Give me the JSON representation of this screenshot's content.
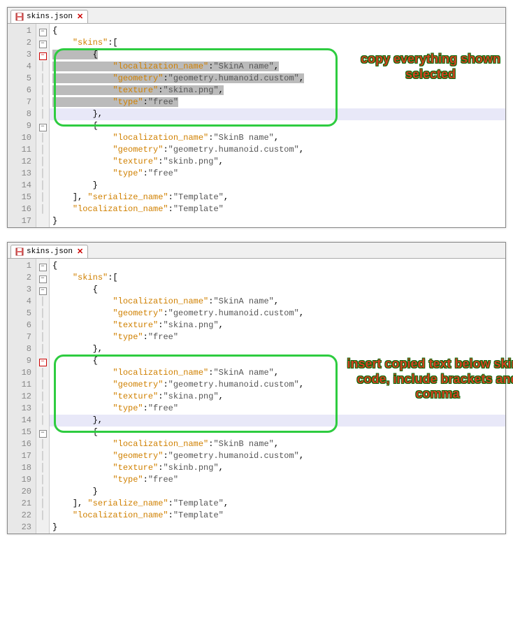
{
  "tab": {
    "filename": "skins.json"
  },
  "annotations": {
    "top": "copy everything\nshown selected",
    "bottom": "insert copied text\nbelow skinA code,\ninclude brackets and\ncomma"
  },
  "top_editor": {
    "lines": [
      {
        "n": 1,
        "fold": "minus",
        "indent": 0,
        "tokens": [
          {
            "t": "p",
            "v": "{"
          }
        ]
      },
      {
        "n": 2,
        "fold": "minus",
        "indent": 1,
        "tokens": [
          {
            "t": "k",
            "v": "\"skins\""
          },
          {
            "t": "p",
            "v": ":["
          }
        ]
      },
      {
        "n": 3,
        "fold": "minus-red",
        "indent": 2,
        "selected": true,
        "tokens": [
          {
            "t": "p",
            "v": "{"
          }
        ]
      },
      {
        "n": 4,
        "fold": "line",
        "indent": 3,
        "selected": true,
        "tokens": [
          {
            "t": "k",
            "v": "\"localization_name\""
          },
          {
            "t": "p",
            "v": ":"
          },
          {
            "t": "s",
            "v": "\"SkinA name\""
          },
          {
            "t": "p",
            "v": ","
          }
        ]
      },
      {
        "n": 5,
        "fold": "line",
        "indent": 3,
        "selected": true,
        "tokens": [
          {
            "t": "k",
            "v": "\"geometry\""
          },
          {
            "t": "p",
            "v": ":"
          },
          {
            "t": "s",
            "v": "\"geometry.humanoid.custom\""
          },
          {
            "t": "p",
            "v": ","
          }
        ]
      },
      {
        "n": 6,
        "fold": "line",
        "indent": 3,
        "selected": true,
        "tokens": [
          {
            "t": "k",
            "v": "\"texture\""
          },
          {
            "t": "p",
            "v": ":"
          },
          {
            "t": "s",
            "v": "\"skina.png\""
          },
          {
            "t": "p",
            "v": ","
          }
        ]
      },
      {
        "n": 7,
        "fold": "line",
        "indent": 3,
        "selected": true,
        "tokens": [
          {
            "t": "k",
            "v": "\"type\""
          },
          {
            "t": "p",
            "v": ":"
          },
          {
            "t": "s",
            "v": "\"free\""
          }
        ]
      },
      {
        "n": 8,
        "fold": "line",
        "indent": 2,
        "cursor": true,
        "tokens": [
          {
            "t": "p",
            "v": "},"
          }
        ]
      },
      {
        "n": 9,
        "fold": "minus",
        "indent": 2,
        "tokens": [
          {
            "t": "p",
            "v": "{"
          }
        ]
      },
      {
        "n": 10,
        "fold": "line",
        "indent": 3,
        "tokens": [
          {
            "t": "k",
            "v": "\"localization_name\""
          },
          {
            "t": "p",
            "v": ":"
          },
          {
            "t": "s",
            "v": "\"SkinB name\""
          },
          {
            "t": "p",
            "v": ","
          }
        ]
      },
      {
        "n": 11,
        "fold": "line",
        "indent": 3,
        "tokens": [
          {
            "t": "k",
            "v": "\"geometry\""
          },
          {
            "t": "p",
            "v": ":"
          },
          {
            "t": "s",
            "v": "\"geometry.humanoid.custom\""
          },
          {
            "t": "p",
            "v": ","
          }
        ]
      },
      {
        "n": 12,
        "fold": "line",
        "indent": 3,
        "tokens": [
          {
            "t": "k",
            "v": "\"texture\""
          },
          {
            "t": "p",
            "v": ":"
          },
          {
            "t": "s",
            "v": "\"skinb.png\""
          },
          {
            "t": "p",
            "v": ","
          }
        ]
      },
      {
        "n": 13,
        "fold": "line",
        "indent": 3,
        "tokens": [
          {
            "t": "k",
            "v": "\"type\""
          },
          {
            "t": "p",
            "v": ":"
          },
          {
            "t": "s",
            "v": "\"free\""
          }
        ]
      },
      {
        "n": 14,
        "fold": "line",
        "indent": 2,
        "tokens": [
          {
            "t": "p",
            "v": "}"
          }
        ]
      },
      {
        "n": 15,
        "fold": "line",
        "indent": 1,
        "tokens": [
          {
            "t": "p",
            "v": "], "
          },
          {
            "t": "k",
            "v": "\"serialize_name\""
          },
          {
            "t": "p",
            "v": ":"
          },
          {
            "t": "s",
            "v": "\"Template\""
          },
          {
            "t": "p",
            "v": ","
          }
        ]
      },
      {
        "n": 16,
        "fold": "line",
        "indent": 1,
        "tokens": [
          {
            "t": "k",
            "v": "\"localization_name\""
          },
          {
            "t": "p",
            "v": ":"
          },
          {
            "t": "s",
            "v": "\"Template\""
          }
        ]
      },
      {
        "n": 17,
        "fold": "",
        "indent": 0,
        "tokens": [
          {
            "t": "p",
            "v": "}"
          }
        ]
      }
    ]
  },
  "bottom_editor": {
    "lines": [
      {
        "n": 1,
        "fold": "minus",
        "indent": 0,
        "tokens": [
          {
            "t": "p",
            "v": "{"
          }
        ]
      },
      {
        "n": 2,
        "fold": "minus",
        "indent": 1,
        "tokens": [
          {
            "t": "k",
            "v": "\"skins\""
          },
          {
            "t": "p",
            "v": ":["
          }
        ]
      },
      {
        "n": 3,
        "fold": "minus",
        "indent": 2,
        "tokens": [
          {
            "t": "p",
            "v": "{"
          }
        ]
      },
      {
        "n": 4,
        "fold": "line",
        "indent": 3,
        "tokens": [
          {
            "t": "k",
            "v": "\"localization_name\""
          },
          {
            "t": "p",
            "v": ":"
          },
          {
            "t": "s",
            "v": "\"SkinA name\""
          },
          {
            "t": "p",
            "v": ","
          }
        ]
      },
      {
        "n": 5,
        "fold": "line",
        "indent": 3,
        "tokens": [
          {
            "t": "k",
            "v": "\"geometry\""
          },
          {
            "t": "p",
            "v": ":"
          },
          {
            "t": "s",
            "v": "\"geometry.humanoid.custom\""
          },
          {
            "t": "p",
            "v": ","
          }
        ]
      },
      {
        "n": 6,
        "fold": "line",
        "indent": 3,
        "tokens": [
          {
            "t": "k",
            "v": "\"texture\""
          },
          {
            "t": "p",
            "v": ":"
          },
          {
            "t": "s",
            "v": "\"skina.png\""
          },
          {
            "t": "p",
            "v": ","
          }
        ]
      },
      {
        "n": 7,
        "fold": "line",
        "indent": 3,
        "tokens": [
          {
            "t": "k",
            "v": "\"type\""
          },
          {
            "t": "p",
            "v": ":"
          },
          {
            "t": "s",
            "v": "\"free\""
          }
        ]
      },
      {
        "n": 8,
        "fold": "line",
        "indent": 2,
        "tokens": [
          {
            "t": "p",
            "v": "},"
          }
        ]
      },
      {
        "n": 9,
        "fold": "minus-red",
        "indent": 2,
        "tokens": [
          {
            "t": "p",
            "v": "{"
          }
        ]
      },
      {
        "n": 10,
        "fold": "line",
        "indent": 3,
        "tokens": [
          {
            "t": "k",
            "v": "\"localization_name\""
          },
          {
            "t": "p",
            "v": ":"
          },
          {
            "t": "s",
            "v": "\"SkinA name\""
          },
          {
            "t": "p",
            "v": ","
          }
        ]
      },
      {
        "n": 11,
        "fold": "line",
        "indent": 3,
        "tokens": [
          {
            "t": "k",
            "v": "\"geometry\""
          },
          {
            "t": "p",
            "v": ":"
          },
          {
            "t": "s",
            "v": "\"geometry.humanoid.custom\""
          },
          {
            "t": "p",
            "v": ","
          }
        ]
      },
      {
        "n": 12,
        "fold": "line",
        "indent": 3,
        "tokens": [
          {
            "t": "k",
            "v": "\"texture\""
          },
          {
            "t": "p",
            "v": ":"
          },
          {
            "t": "s",
            "v": "\"skina.png\""
          },
          {
            "t": "p",
            "v": ","
          }
        ]
      },
      {
        "n": 13,
        "fold": "line",
        "indent": 3,
        "tokens": [
          {
            "t": "k",
            "v": "\"type\""
          },
          {
            "t": "p",
            "v": ":"
          },
          {
            "t": "s",
            "v": "\"free\""
          }
        ]
      },
      {
        "n": 14,
        "fold": "line",
        "indent": 2,
        "cursor": true,
        "tokens": [
          {
            "t": "p",
            "v": "},"
          }
        ]
      },
      {
        "n": 15,
        "fold": "minus",
        "indent": 2,
        "tokens": [
          {
            "t": "p",
            "v": "{"
          }
        ]
      },
      {
        "n": 16,
        "fold": "line",
        "indent": 3,
        "tokens": [
          {
            "t": "k",
            "v": "\"localization_name\""
          },
          {
            "t": "p",
            "v": ":"
          },
          {
            "t": "s",
            "v": "\"SkinB name\""
          },
          {
            "t": "p",
            "v": ","
          }
        ]
      },
      {
        "n": 17,
        "fold": "line",
        "indent": 3,
        "tokens": [
          {
            "t": "k",
            "v": "\"geometry\""
          },
          {
            "t": "p",
            "v": ":"
          },
          {
            "t": "s",
            "v": "\"geometry.humanoid.custom\""
          },
          {
            "t": "p",
            "v": ","
          }
        ]
      },
      {
        "n": 18,
        "fold": "line",
        "indent": 3,
        "tokens": [
          {
            "t": "k",
            "v": "\"texture\""
          },
          {
            "t": "p",
            "v": ":"
          },
          {
            "t": "s",
            "v": "\"skinb.png\""
          },
          {
            "t": "p",
            "v": ","
          }
        ]
      },
      {
        "n": 19,
        "fold": "line",
        "indent": 3,
        "tokens": [
          {
            "t": "k",
            "v": "\"type\""
          },
          {
            "t": "p",
            "v": ":"
          },
          {
            "t": "s",
            "v": "\"free\""
          }
        ]
      },
      {
        "n": 20,
        "fold": "line",
        "indent": 2,
        "tokens": [
          {
            "t": "p",
            "v": "}"
          }
        ]
      },
      {
        "n": 21,
        "fold": "line",
        "indent": 1,
        "tokens": [
          {
            "t": "p",
            "v": "], "
          },
          {
            "t": "k",
            "v": "\"serialize_name\""
          },
          {
            "t": "p",
            "v": ":"
          },
          {
            "t": "s",
            "v": "\"Template\""
          },
          {
            "t": "p",
            "v": ","
          }
        ]
      },
      {
        "n": 22,
        "fold": "line",
        "indent": 1,
        "tokens": [
          {
            "t": "k",
            "v": "\"localization_name\""
          },
          {
            "t": "p",
            "v": ":"
          },
          {
            "t": "s",
            "v": "\"Template\""
          }
        ]
      },
      {
        "n": 23,
        "fold": "",
        "indent": 0,
        "tokens": [
          {
            "t": "p",
            "v": "}"
          }
        ]
      }
    ]
  }
}
